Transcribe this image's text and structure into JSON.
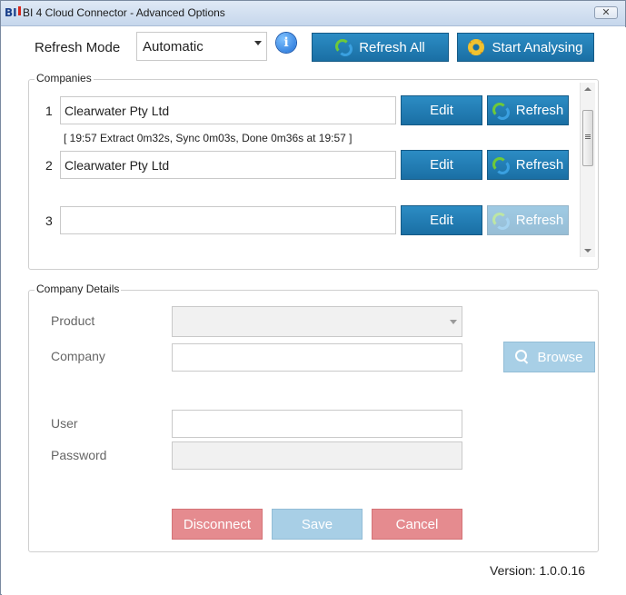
{
  "window": {
    "title": "BI 4 Cloud Connector - Advanced Options",
    "app_icon_text": "BI",
    "close_glyph": "✕"
  },
  "top_bar": {
    "refresh_mode_label": "Refresh Mode",
    "refresh_mode_value": "Automatic",
    "info_glyph": "i",
    "refresh_all_label": "Refresh All",
    "start_analysing_label": "Start Analysing"
  },
  "companies": {
    "legend": "Companies",
    "rows": [
      {
        "num": "1",
        "name": "Clearwater Pty Ltd",
        "status": "[ 19:57  Extract 0m32s, Sync 0m03s, Done 0m36s at 19:57 ]",
        "edit_label": "Edit",
        "refresh_label": "Refresh"
      },
      {
        "num": "2",
        "name": "Clearwater Pty Ltd",
        "status": "",
        "edit_label": "Edit",
        "refresh_label": "Refresh"
      },
      {
        "num": "3",
        "name": "",
        "status": "",
        "edit_label": "Edit",
        "refresh_label": "Refresh"
      }
    ]
  },
  "company_details": {
    "legend": "Company Details",
    "product_label": "Product",
    "product_value": "",
    "company_label": "Company",
    "company_value": "",
    "browse_label": "Browse",
    "user_label": "User",
    "user_value": "",
    "password_label": "Password",
    "password_value": "",
    "disconnect_label": "Disconnect",
    "save_label": "Save",
    "cancel_label": "Cancel"
  },
  "footer": {
    "version": "Version: 1.0.0.16"
  },
  "colors": {
    "accent": "#1f7db4",
    "danger": "#e58b8f",
    "disabled_blue": "#a8cfe6"
  }
}
